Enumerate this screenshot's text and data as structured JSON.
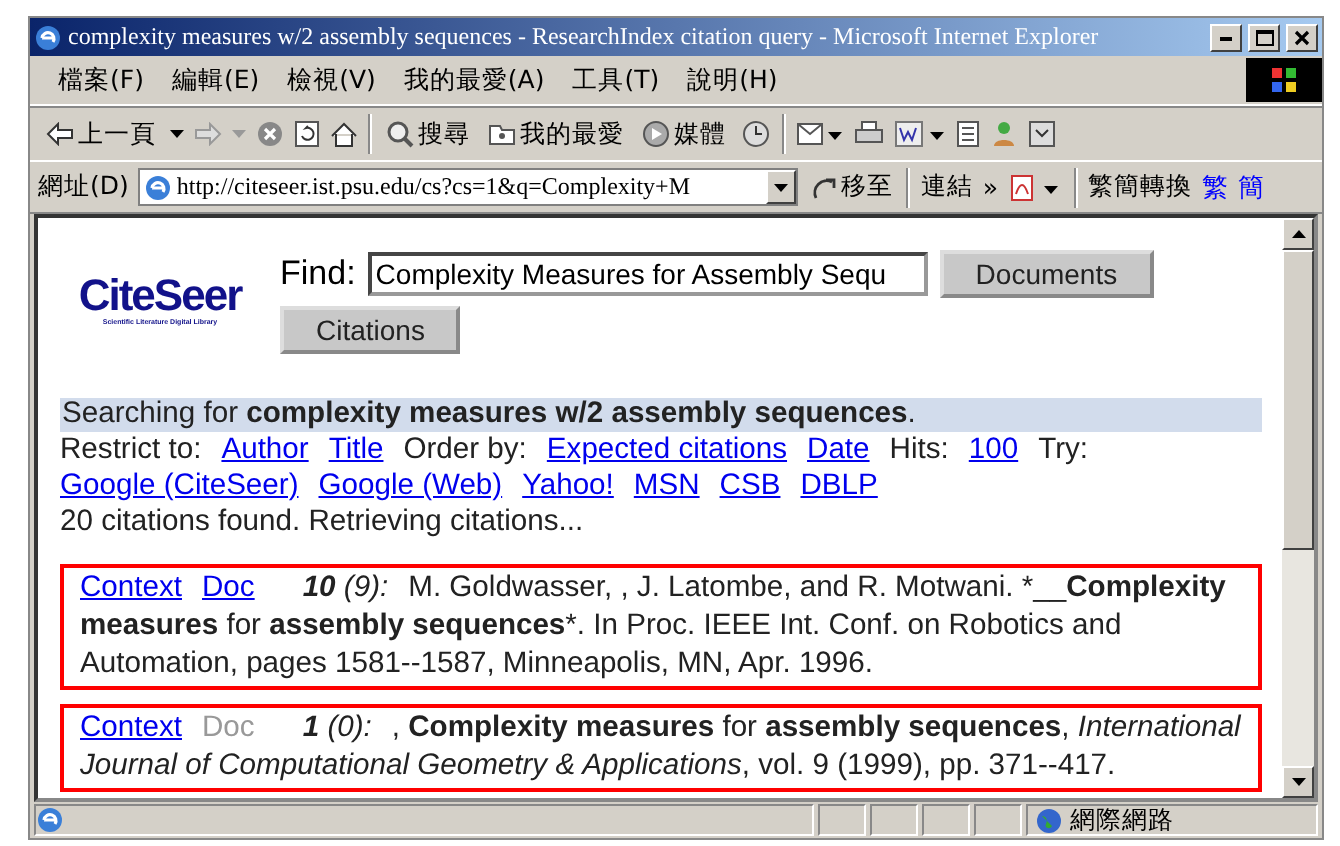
{
  "window": {
    "title": "complexity measures w/2 assembly sequences - ResearchIndex citation query - Microsoft Internet Explorer"
  },
  "menu": [
    "檔案(F)",
    "編輯(E)",
    "檢視(V)",
    "我的最愛(A)",
    "工具(T)",
    "說明(H)"
  ],
  "toolbar": {
    "back": "上一頁",
    "search": "搜尋",
    "favorites": "我的最愛",
    "media": "媒體"
  },
  "address_bar": {
    "label": "網址(D)",
    "value": "http://citeseer.ist.psu.edu/cs?cs=1&q=Complexity+M",
    "go": "移至",
    "links": "連結",
    "links_more": "»",
    "convert": "繁簡轉換",
    "traditional": "繁",
    "simplified": "簡"
  },
  "page": {
    "logo": "CiteSeer",
    "logo_tagline": "Scientific Literature Digital Library",
    "find_label": "Find:",
    "find_value": "Complexity Measures for Assembly Sequ",
    "buttons": [
      "Documents",
      "Citations"
    ],
    "searching": "Searching for **complexity measures w/2 assembly sequences**.",
    "restrict_label": "Restrict to:",
    "restrict_links": [
      "Author",
      "Title"
    ],
    "order_label": "Order by:",
    "order_links": [
      "Expected citations",
      "Date"
    ],
    "hits_label": "Hits:",
    "hits_link": "100",
    "try_label": "Try:",
    "try_links": [
      "Google (CiteSeer)",
      "Google (Web)",
      "Yahoo!",
      "MSN",
      "CSB",
      "DBLP"
    ],
    "status_text": "20 citations found. Retrieving citations...",
    "citations": [
      {
        "context": "Context",
        "doc": "Doc",
        "doc_enabled": true,
        "count": "10",
        "self": "(9):",
        "text": "M. Goldwasser, , J. Latombe, and R. Motwani. *__**Complexity measures** for **assembly sequences***. In Proc. IEEE Int. Conf. on Robotics and Automation, pages 1581--1587, Minneapolis, MN, Apr. 1996."
      },
      {
        "context": "Context",
        "doc": "Doc",
        "doc_enabled": false,
        "count": "1",
        "self": "(0):",
        "text": ", **Complexity measures** for **assembly sequences**, *International Journal of Computational Geometry & Applications*, vol. 9 (1999), pp. 371--417."
      }
    ]
  },
  "status_bar": {
    "zone": "網際網路"
  }
}
